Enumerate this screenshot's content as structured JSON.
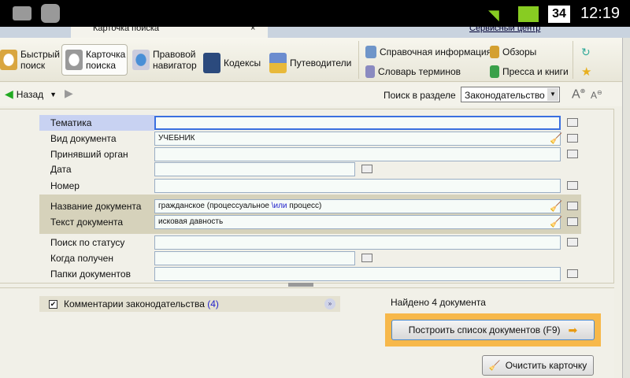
{
  "status_bar": {
    "battery": "34",
    "time": "12:19"
  },
  "tabs": {
    "active_tab": "Карточка поиска",
    "service_link": "Сервисный центр"
  },
  "toolbar": {
    "quick_search": [
      "Быстрый",
      "поиск"
    ],
    "search_card": [
      "Карточка",
      "поиска"
    ],
    "legal_navigator": [
      "Правовой",
      "навигатор"
    ],
    "codes": "Кодексы",
    "guides": "Путеводители",
    "reference_info": "Справочная информация",
    "reviews": "Обзоры",
    "glossary": "Словарь терминов",
    "press_books": "Пресса и книги"
  },
  "nav": {
    "back": "Назад",
    "section_label": "Поиск в разделе",
    "section_value": "Законодательство"
  },
  "form": {
    "fields": [
      {
        "label": "Тематика",
        "value": ""
      },
      {
        "label": "Вид документа",
        "value": "УЧЕБНИК"
      },
      {
        "label": "Принявший орган",
        "value": ""
      },
      {
        "label": "Дата",
        "value": ""
      },
      {
        "label": "Номер",
        "value": ""
      },
      {
        "label": "Название документа",
        "value_a": "гражданское (процессуальное ",
        "value_op": "\\или",
        "value_b": " процесс)"
      },
      {
        "label": "Текст документа",
        "value": "исковая давность"
      },
      {
        "label": "Поиск по статусу",
        "value": ""
      },
      {
        "label": "Когда получен",
        "value": ""
      },
      {
        "label": "Папки документов",
        "value": ""
      }
    ]
  },
  "bottom": {
    "comments_label": "Комментарии законодательства",
    "comments_count": "(4)",
    "found": "Найдено 4 документа",
    "build_button": "Построить список документов (F9)",
    "clear_button": "Очистить карточку"
  }
}
